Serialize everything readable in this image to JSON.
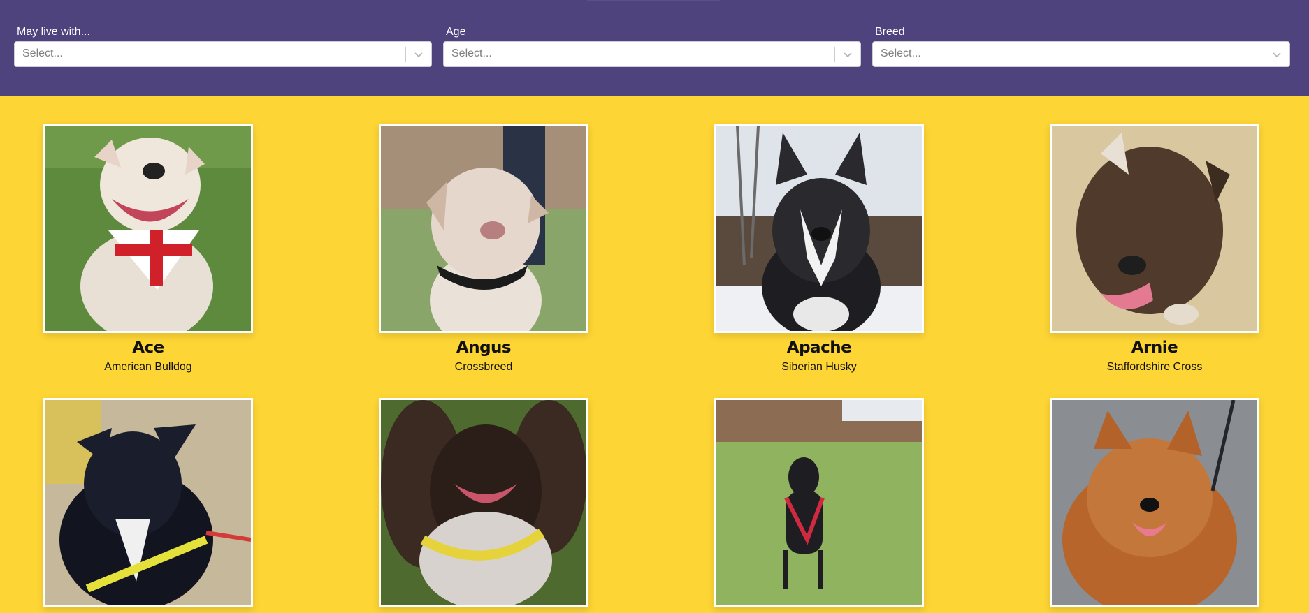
{
  "filters": [
    {
      "label": "May live with...",
      "placeholder": "Select..."
    },
    {
      "label": "Age",
      "placeholder": "Select..."
    },
    {
      "label": "Breed",
      "placeholder": "Select..."
    }
  ],
  "dogs": [
    {
      "name": "Ace",
      "breed": "American Bulldog"
    },
    {
      "name": "Angus",
      "breed": "Crossbreed"
    },
    {
      "name": "Apache",
      "breed": "Siberian Husky"
    },
    {
      "name": "Arnie",
      "breed": "Staffordshire Cross"
    },
    {
      "name": "",
      "breed": ""
    },
    {
      "name": "",
      "breed": ""
    },
    {
      "name": "",
      "breed": ""
    },
    {
      "name": "",
      "breed": ""
    }
  ],
  "colors": {
    "header_bg": "#4e437d",
    "page_bg": "#fdd535",
    "photo_border": "#ffffff"
  },
  "icons": {
    "select_indicator": "chevron-down-icon"
  }
}
